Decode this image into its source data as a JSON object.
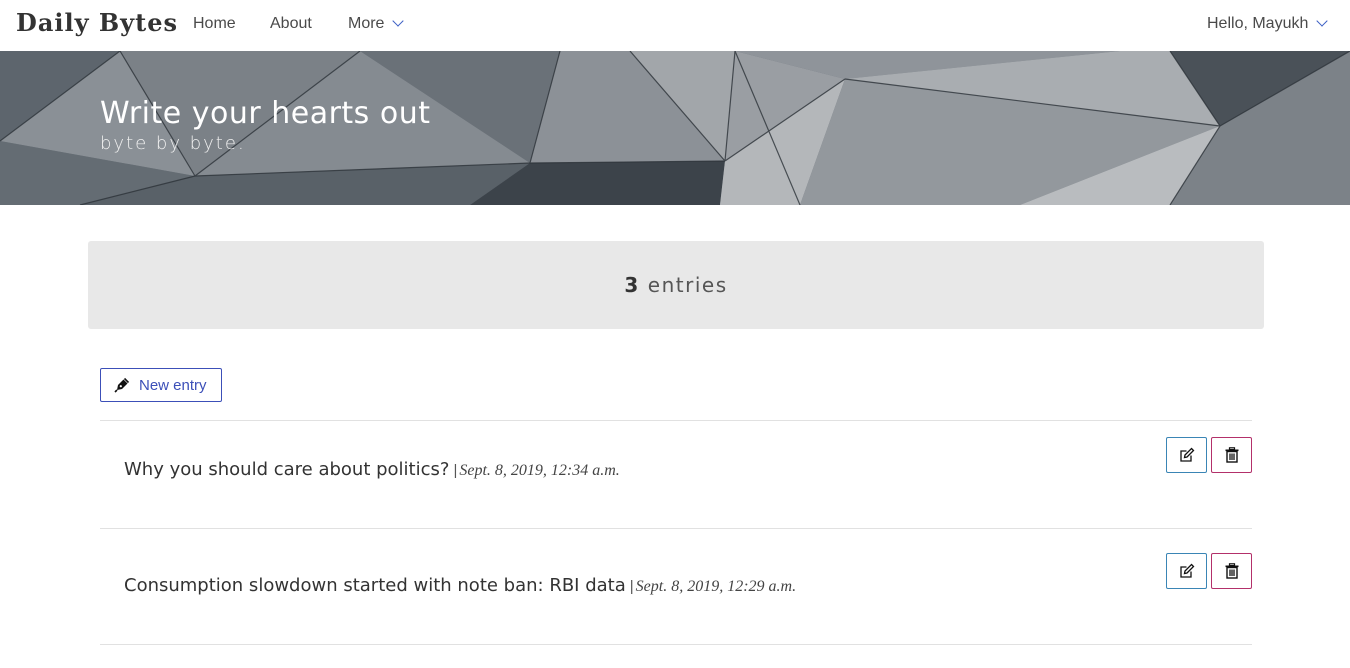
{
  "navbar": {
    "brand": "Daily Bytes",
    "links": [
      "Home",
      "About",
      "More"
    ],
    "user_menu": "Hello, Mayukh"
  },
  "hero": {
    "title": "Write your hearts out",
    "subtitle": "byte by byte."
  },
  "summary": {
    "count": "3",
    "label": "entries"
  },
  "actions": {
    "new_entry_label": "New entry"
  },
  "entries": [
    {
      "title": "Why you should care about politics?",
      "separator": "|",
      "date": "Sept. 8, 2019, 12:34 a.m."
    },
    {
      "title": "Consumption slowdown started with note ban: RBI data",
      "separator": "|",
      "date": "Sept. 8, 2019, 12:29 a.m."
    }
  ],
  "icons": {
    "edit": "edit-icon",
    "delete": "trash-icon",
    "new_entry": "pen-icon",
    "dropdown": "chevron-down-icon"
  },
  "colors": {
    "accent_blue": "#3c4fb8",
    "edit_border": "#3a85b5",
    "delete_border": "#b3306a",
    "count_box_bg": "#e8e8e8"
  }
}
